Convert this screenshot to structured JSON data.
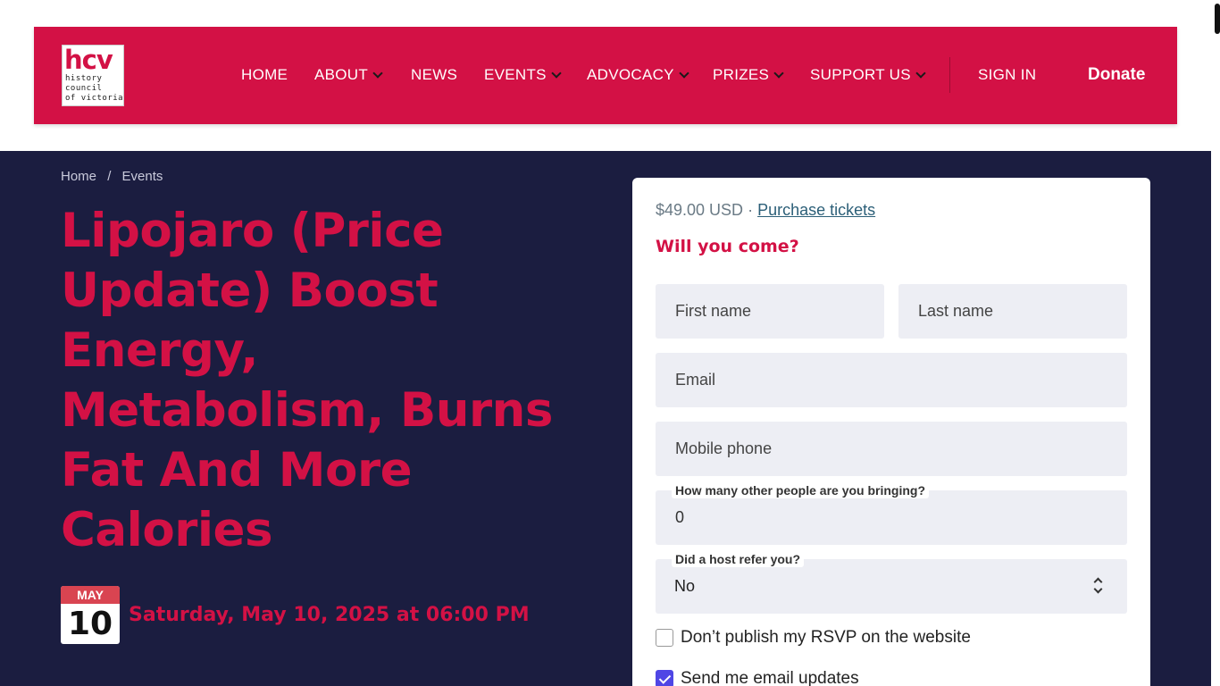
{
  "logo": {
    "mark": "hcv",
    "line1": "history",
    "line2": "council",
    "line3": "of victoria"
  },
  "nav": {
    "items": [
      {
        "label": "HOME",
        "dropdown": false
      },
      {
        "label": "ABOUT",
        "dropdown": true
      },
      {
        "label": "NEWS",
        "dropdown": false
      },
      {
        "label": "EVENTS",
        "dropdown": true
      },
      {
        "label": "ADVOCACY",
        "dropdown": true
      },
      {
        "label": "PRIZES",
        "dropdown": true
      },
      {
        "label": "SUPPORT US",
        "dropdown": true
      }
    ],
    "sign_in": "SIGN IN",
    "donate": "Donate"
  },
  "breadcrumb": {
    "home": "Home",
    "separator": "/",
    "current": "Events"
  },
  "event": {
    "title": "Lipojaro (Price Update) Boost Energy, Metabolism, Burns Fat And More Calories",
    "month": "MAY",
    "day": "10",
    "datetime": "Saturday, May 10, 2025 at 06:00 PM"
  },
  "rsvp": {
    "price": "$49.00 USD",
    "price_separator": "·",
    "purchase_link": "Purchase tickets",
    "heading": "Will you come?",
    "first_name_placeholder": "First name",
    "last_name_placeholder": "Last name",
    "email_placeholder": "Email",
    "phone_placeholder": "Mobile phone",
    "guests_label": "How many other people are you bringing?",
    "guests_value": "0",
    "host_label": "Did a host refer you?",
    "host_value": "No",
    "dont_publish_label": "Don’t publish my RSVP on the website",
    "dont_publish_checked": false,
    "email_updates_label": "Send me email updates",
    "email_updates_checked": true
  },
  "colors": {
    "brand": "#d31145",
    "navy": "#1b1d40",
    "field_bg": "#edeef4",
    "checkbox_accent": "#4f46e5"
  }
}
